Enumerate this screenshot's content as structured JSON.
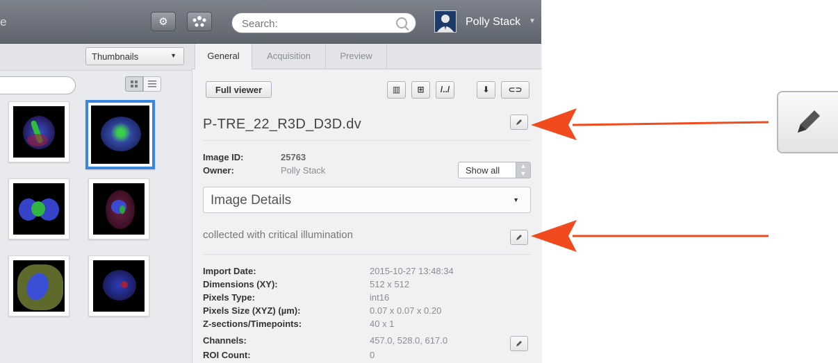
{
  "header": {
    "title_fragment": "e",
    "search_placeholder": "Search:",
    "user_name": "Polly Stack"
  },
  "left_panel": {
    "view_select_value": "Thumbnails",
    "filter_value": ""
  },
  "tabs": [
    {
      "label": "General",
      "active": true
    },
    {
      "label": "Acquisition",
      "active": false
    },
    {
      "label": "Preview",
      "active": false
    }
  ],
  "toolbar": {
    "full_viewer_label": "Full viewer"
  },
  "image": {
    "name": "P-TRE_22_R3D_D3D.dv",
    "id_label": "Image ID:",
    "id_value": "25763",
    "owner_label": "Owner:",
    "owner_value": "Polly Stack",
    "show_all": "Show all",
    "details_header": "Image Details",
    "description": "collected with critical illumination"
  },
  "details": [
    {
      "label": "Import Date:",
      "value": "2015-10-27 13:48:34"
    },
    {
      "label": "Dimensions (XY):",
      "value": "512 x 512"
    },
    {
      "label": "Pixels Type:",
      "value": "int16"
    },
    {
      "label": "Pixels Size (XYZ) (µm):",
      "value": "0.07 x 0.07 x 0.20"
    },
    {
      "label": "Z-sections/Timepoints:",
      "value": "40 x 1"
    },
    {
      "label": "Channels:",
      "value": "457.0, 528.0, 617.0"
    },
    {
      "label": "ROI Count:",
      "value": "0"
    }
  ],
  "colors": {
    "accent_selection": "#3a87df",
    "annotation_arrow": "#f04a1e"
  }
}
